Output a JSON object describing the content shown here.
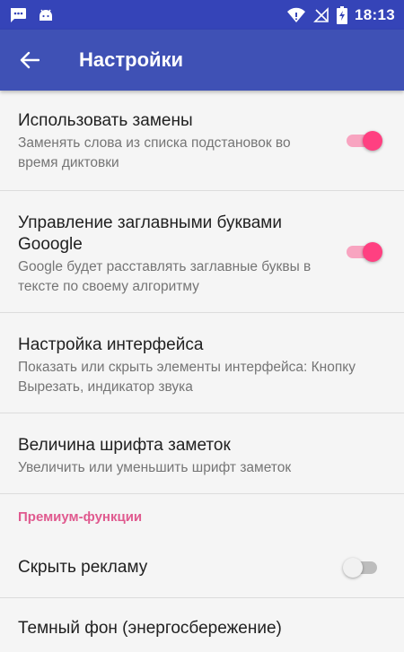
{
  "status_bar": {
    "time": "18:13",
    "left_icons": [
      "message-icon",
      "android-icon"
    ],
    "right_icons": [
      "wifi-icon",
      "no-signal-icon",
      "battery-charging-icon"
    ],
    "color": "#3544b8"
  },
  "app_bar": {
    "title": "Настройки",
    "back_icon": "arrow-left-icon",
    "color": "#3f51b5"
  },
  "settings": [
    {
      "title": "Использовать замены",
      "subtitle": "Заменять слова из списка подстановок во время диктовки",
      "toggle": true
    },
    {
      "title": "Управление заглавными буквами Gooogle",
      "subtitle": "Google будет расставлять заглавные буквы в тексте по своему алгоритму",
      "toggle": true
    },
    {
      "title": "Настройка интерфейса",
      "subtitle": "Показать или скрыть элементы интерфейса: Кнопку Вырезать, индикатор звука"
    },
    {
      "title": "Величина шрифта заметок",
      "subtitle": "Увеличить или уменьшить шрифт заметок"
    }
  ],
  "premium_section": {
    "header": "Премиум-функции",
    "items": [
      {
        "title": "Скрыть рекламу",
        "toggle": false
      },
      {
        "title": "Темный фон (энергосбережение)"
      }
    ]
  },
  "colors": {
    "accent": "#ff4081",
    "section_header": "#e05a8f"
  }
}
